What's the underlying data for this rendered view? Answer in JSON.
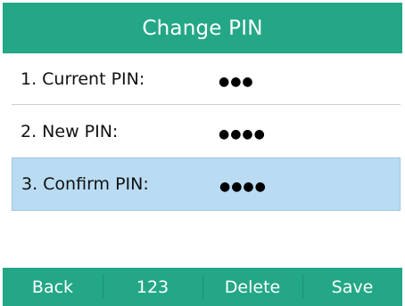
{
  "header": {
    "title": "Change PIN"
  },
  "fields": [
    {
      "label": "1. Current PIN:",
      "value": "●●●"
    },
    {
      "label": "2. New PIN:",
      "value": "●●●●"
    },
    {
      "label": "3. Confirm PIN:",
      "value": "●●●●"
    }
  ],
  "selected_field_index": 2,
  "softkeys": [
    "Back",
    "123",
    "Delete",
    "Save"
  ],
  "colors": {
    "accent": "#24a786",
    "selection": "#b9dcf3"
  }
}
